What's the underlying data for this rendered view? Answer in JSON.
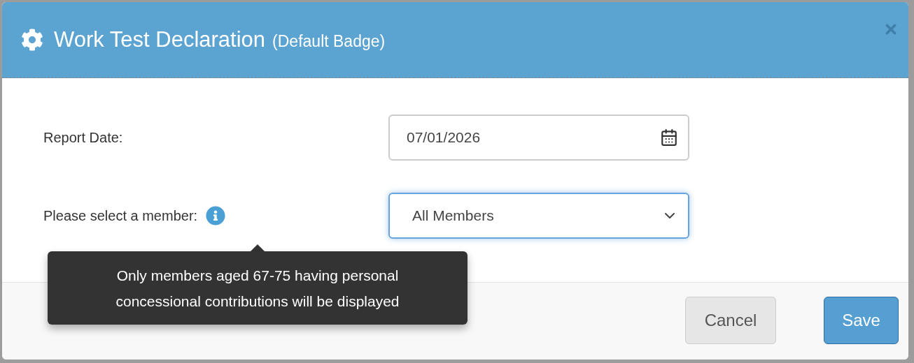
{
  "dialog": {
    "title": "Work Test Declaration",
    "subtitle": "(Default Badge)"
  },
  "fields": [
    {
      "kind": "date",
      "label": "Report Date:",
      "value": "07/01/2026",
      "focused": false,
      "info": false
    },
    {
      "kind": "select",
      "label": "Please select a member:",
      "value": "All Members",
      "focused": true,
      "info": true
    }
  ],
  "tooltip": {
    "text": "Only members aged 67-75 having personal concessional contributions will be displayed"
  },
  "buttons": [
    {
      "label": "Cancel",
      "kind": "default"
    },
    {
      "label": "Save",
      "kind": "primary"
    }
  ]
}
